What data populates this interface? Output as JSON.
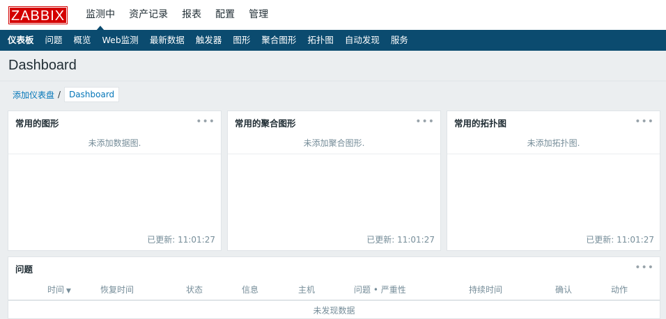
{
  "logo": "ZABBIX",
  "topnav": [
    "监测中",
    "资产记录",
    "报表",
    "配置",
    "管理"
  ],
  "subnav": [
    "仪表板",
    "问题",
    "概览",
    "Web监测",
    "最新数据",
    "触发器",
    "图形",
    "聚合图形",
    "拓扑图",
    "自动发现",
    "服务"
  ],
  "page_title": "Dashboard",
  "breadcrumb": {
    "link": "添加仪表盘",
    "sep": "/",
    "current": "Dashboard"
  },
  "widgets": [
    {
      "title": "常用的图形",
      "empty": "未添加数据图.",
      "updated": "已更新: 11:01:27"
    },
    {
      "title": "常用的聚合图形",
      "empty": "未添加聚合图形.",
      "updated": "已更新: 11:01:27"
    },
    {
      "title": "常用的拓扑图",
      "empty": "未添加拓扑图.",
      "updated": "已更新: 11:01:27"
    }
  ],
  "problems": {
    "title": "问题",
    "columns": [
      "时间",
      "恢复时间",
      "状态",
      "信息",
      "主机",
      "问题 • 严重性",
      "持续时间",
      "确认",
      "动作"
    ],
    "empty": "未发现数据"
  },
  "menu_dots": "•••"
}
